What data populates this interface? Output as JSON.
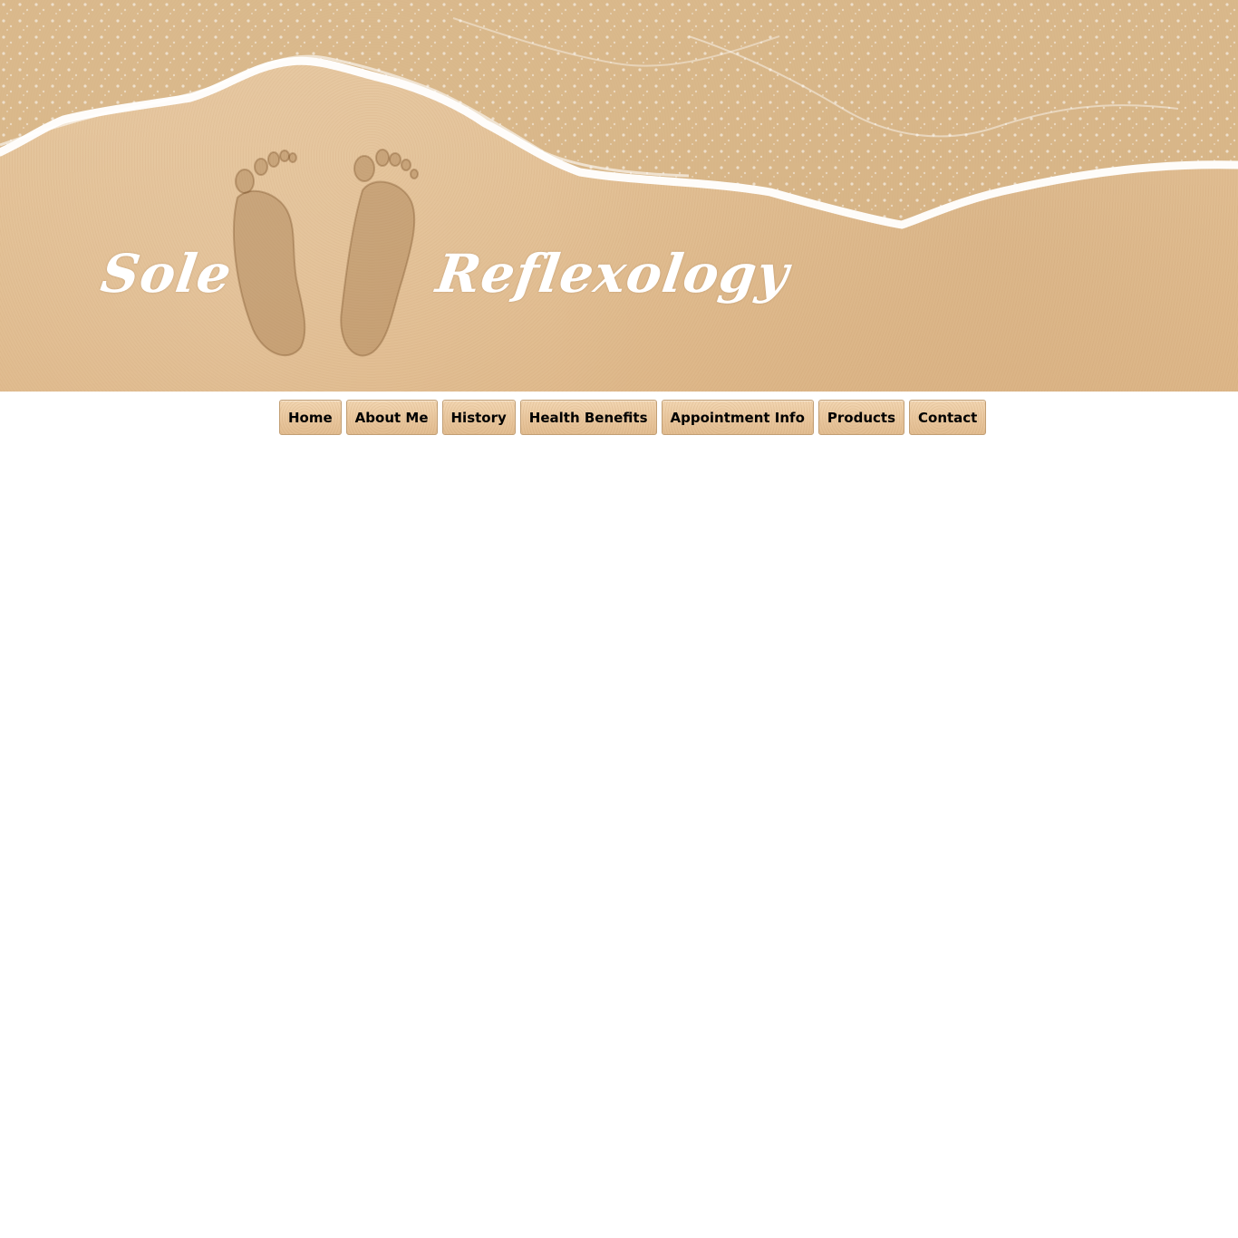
{
  "header": {
    "title_word_1": "Sole",
    "title_word_2": "Reflexology",
    "footprints_icon": "footprints-icon",
    "background": "beach-sand-with-wave",
    "colors": {
      "sand": "#e3c196",
      "foam": "#ffffff",
      "title": "#ffffff"
    }
  },
  "nav": {
    "items": [
      {
        "label": "Home"
      },
      {
        "label": "About Me"
      },
      {
        "label": "History"
      },
      {
        "label": "Health Benefits"
      },
      {
        "label": "Appointment Info"
      },
      {
        "label": "Products"
      },
      {
        "label": "Contact"
      }
    ],
    "colors": {
      "button_bg": "#e9c79e",
      "button_text": "#000000",
      "button_border": "#c29f75"
    }
  }
}
